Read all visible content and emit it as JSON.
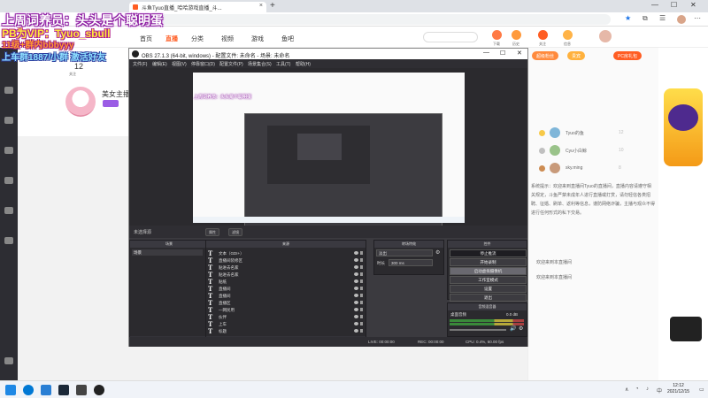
{
  "browser": {
    "tab_title": "斗鱼Tyuo直播_哈哈游戏直播_斗...",
    "new_tab": "+",
    "min": "—",
    "max": "☐",
    "close": "✕"
  },
  "overlay": {
    "line1": "上周词养员：头头是个聪明蛋",
    "line2": "PB为VIP：Tyuo_sbull",
    "line3": "11级+群内bbbyyy",
    "line4": "上车群1887/小群 激活好友"
  },
  "douyu": {
    "nav": [
      "首页",
      "直播",
      "分类",
      "视频",
      "游戏",
      "鱼吧"
    ],
    "active_nav": "直播",
    "header_icons": [
      "下载",
      "历史",
      "关注",
      "信息"
    ],
    "follow_count": "12",
    "follow_label": "关注",
    "streamer_category": "美女主播"
  },
  "chat": {
    "tabs": [
      "超级粉丝",
      "贵宾",
      "PC房礼包"
    ],
    "ranks": [
      {
        "name": "Tyuo的鱼",
        "value": "12"
      },
      {
        "name": "Cyu小白鲸",
        "value": "10"
      },
      {
        "name": "sky.ming",
        "value": "8"
      }
    ],
    "notice": "系统提示：欢迎来到直播间Tyuo的直播间，直播内容请遵守相关规定，斗鱼严禁未成年人进行直播或打赏，请勿轻信各类招聘、征婚、刷单、返利等信息，谨防网络诈骗，主播与观众不得进行任何形式的私下交易。",
    "lines": [
      "欢迎来到本直播间",
      "欢迎来到本直播间"
    ]
  },
  "obs": {
    "title": "OBS 27.1.3 (64-bit, windows) - 配置文件: 未命名 - 场景: 未命名",
    "menu": [
      "文件(F)",
      "编辑(E)",
      "视图(V)",
      "停靠窗口(D)",
      "配置文件(P)",
      "场景集合(S)",
      "工具(T)",
      "帮助(H)"
    ],
    "preview_overlay": "上周词养员：头头是个聪明蛋",
    "no_source": "未选择源",
    "props_button": "属性",
    "filters_button": "滤镜",
    "docks": {
      "scenes": "场景",
      "sources": "来源",
      "transitions": "转场特效",
      "controls": "控件",
      "mixer": "音频混音器"
    },
    "scene_list": [
      "场景"
    ],
    "sources": [
      "文本（GDI+）",
      "直播间装修区",
      "贴进去名家",
      "贴进去名家",
      "贴纸",
      "直播间",
      "直播间",
      "直播区",
      "—网民用",
      "伙伴",
      "上车",
      "标题"
    ],
    "transition": {
      "type": "淡出",
      "duration_label": "时长",
      "duration_value": "300 ms"
    },
    "controls": [
      "停止推流",
      "开始录制",
      "启动虚拟摄像机",
      "工作室模式",
      "设置",
      "退出"
    ],
    "mixer": {
      "name": "桌面音频",
      "level": "0.0 dB"
    },
    "status": {
      "live": "LIVE: 00:00:00",
      "rec": "REC: 00:00:00",
      "cpu": "CPU: 0.4%, 60.00 fps"
    }
  },
  "taskbar": {
    "time": "12:12",
    "date": "2021/12/15"
  },
  "colors": {
    "douyu_orange": "#ff5d23",
    "obs_dark": "#2b2a2e",
    "overlay_purple": "#8a1a9f"
  }
}
